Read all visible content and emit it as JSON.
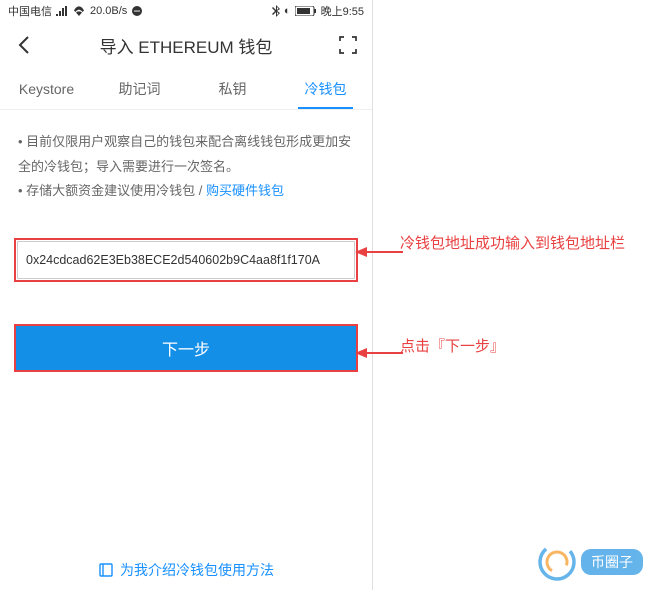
{
  "statusBar": {
    "carrier": "中国电信",
    "speed": "20.0B/s",
    "time": "晚上9:55"
  },
  "header": {
    "title": "导入 ETHEREUM 钱包"
  },
  "tabs": {
    "items": [
      {
        "label": "Keystore"
      },
      {
        "label": "助记词"
      },
      {
        "label": "私钥"
      },
      {
        "label": "冷钱包"
      }
    ]
  },
  "info": {
    "line1": "• 目前仅限用户观察自己的钱包来配合离线钱包形成更加安全的冷钱包；导入需要进行一次签名。",
    "line2prefix": "• 存储大额资金建议使用冷钱包 / ",
    "link": "购买硬件钱包"
  },
  "input": {
    "value": "0x24cdcad62E3Eb38ECE2d540602b9C4aa8f1f170A"
  },
  "button": {
    "next": "下一步"
  },
  "bottomLink": {
    "text": "为我介绍冷钱包使用方法"
  },
  "annotations": {
    "address": "冷钱包地址成功输入到钱包地址栏",
    "next": "点击『下一步』"
  },
  "watermark": {
    "text": "币圈子"
  }
}
